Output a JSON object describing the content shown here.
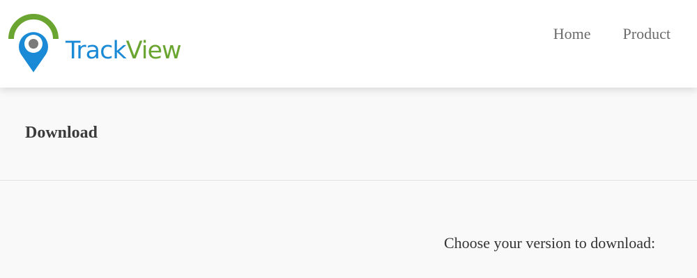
{
  "logo": {
    "text_part1": "Track",
    "text_part2": "View",
    "icon": "location-pin-icon",
    "colors": {
      "blue": "#1a8ad6",
      "green": "#6aa531"
    }
  },
  "nav": {
    "items": [
      {
        "label": "Home"
      },
      {
        "label": "Product"
      }
    ]
  },
  "page": {
    "title": "Download"
  },
  "content": {
    "prompt": "Choose your version to download:"
  }
}
